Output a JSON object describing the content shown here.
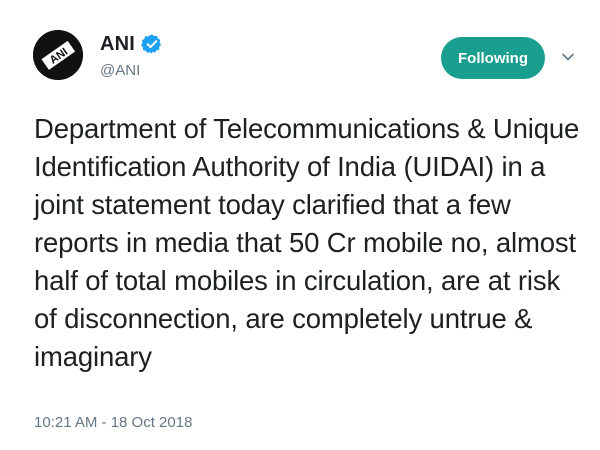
{
  "tweet": {
    "author": {
      "avatar_text": "ANI",
      "display_name": "ANI",
      "handle": "@ANI",
      "verified": true
    },
    "follow_button_label": "Following",
    "menu_icon": "chevron-down-icon",
    "text_lines": [
      "Department of Telecommunications & Unique",
      "Identification Authority of India (UIDAI) in a",
      "joint statement today clarified that a few",
      "reports in media that 50 Cr mobile no, almost",
      "half of total mobiles in circulation, are at risk",
      "of disconnection, are completely untrue &",
      "imaginary"
    ],
    "timestamp": "10:21 AM - 18 Oct 2018"
  },
  "colors": {
    "follow_button": "#1a9e8f",
    "verified_badge": "#1da1f2",
    "secondary_text": "#657786",
    "primary_text": "#1c2022"
  }
}
